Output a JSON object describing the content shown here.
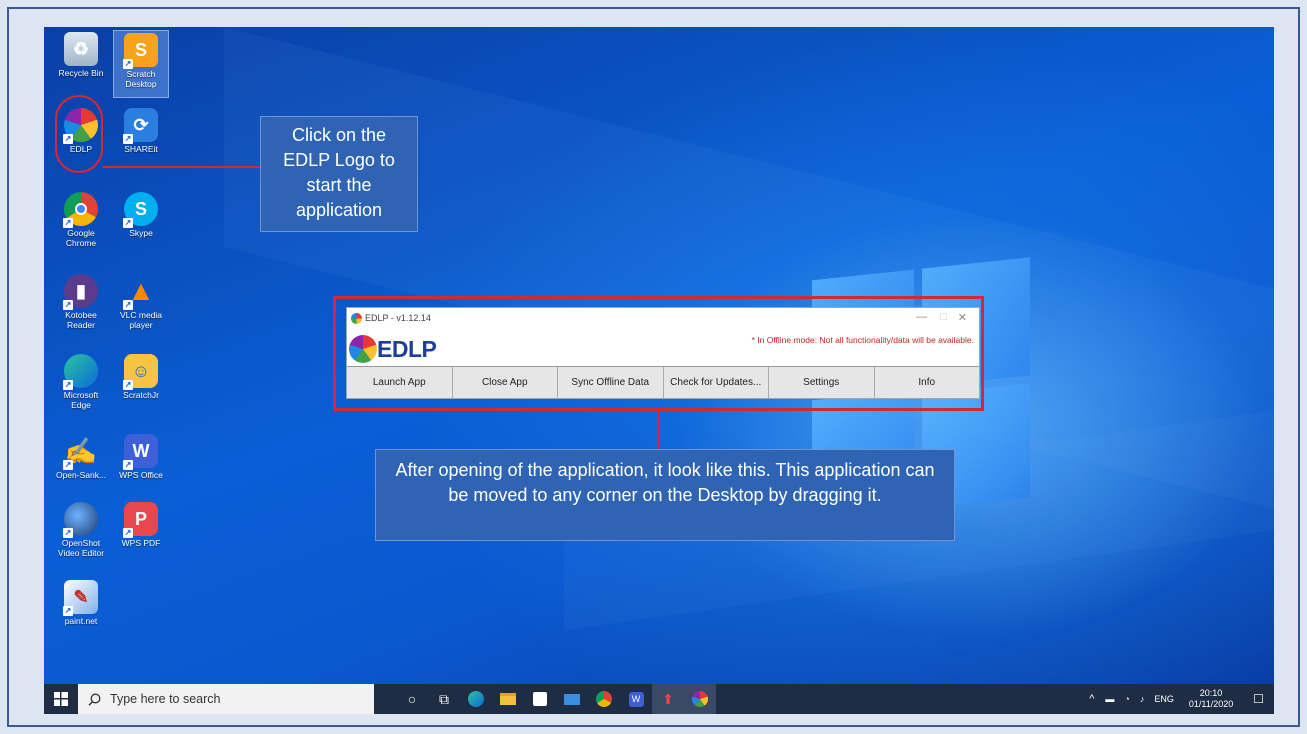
{
  "desktop_icons": [
    {
      "label": "Recycle Bin"
    },
    {
      "label": "Scratch Desktop"
    },
    {
      "label": "EDLP"
    },
    {
      "label": "SHAREit"
    },
    {
      "label": "Google Chrome"
    },
    {
      "label": "Skype"
    },
    {
      "label": "Kotobee Reader"
    },
    {
      "label": "VLC media player"
    },
    {
      "label": "Microsoft Edge"
    },
    {
      "label": "ScratchJr"
    },
    {
      "label": "Open-Sank..."
    },
    {
      "label": "WPS Office"
    },
    {
      "label": "OpenShot Video Editor"
    },
    {
      "label": "WPS PDF"
    },
    {
      "label": "paint.net"
    }
  ],
  "callouts": {
    "top": "Click on the EDLP Logo to start the application",
    "bottom": "After opening of the application, it look like this. This application can be moved to any corner on the Desktop by dragging it."
  },
  "app_window": {
    "title": "EDLP - v1.12.14",
    "logo_text": "EDLP",
    "offline_notice": "* In Offline mode: Not all functionality/data will be available.",
    "buttons": [
      "Launch App",
      "Close App",
      "Sync Offline Data",
      "Check for Updates...",
      "Settings",
      "Info"
    ],
    "minimize": "—",
    "maximize": "□",
    "close": "✕"
  },
  "taskbar": {
    "search_placeholder": "Type here to search",
    "tray_expand": "^",
    "language": "ENG",
    "time": "20:10",
    "date": "01/11/2020"
  },
  "colors": {
    "callout_bg": "#2f64b4",
    "highlight_red": "#d5263a",
    "taskbar_bg": "#1e2d44",
    "offline_red": "#cc2222"
  }
}
